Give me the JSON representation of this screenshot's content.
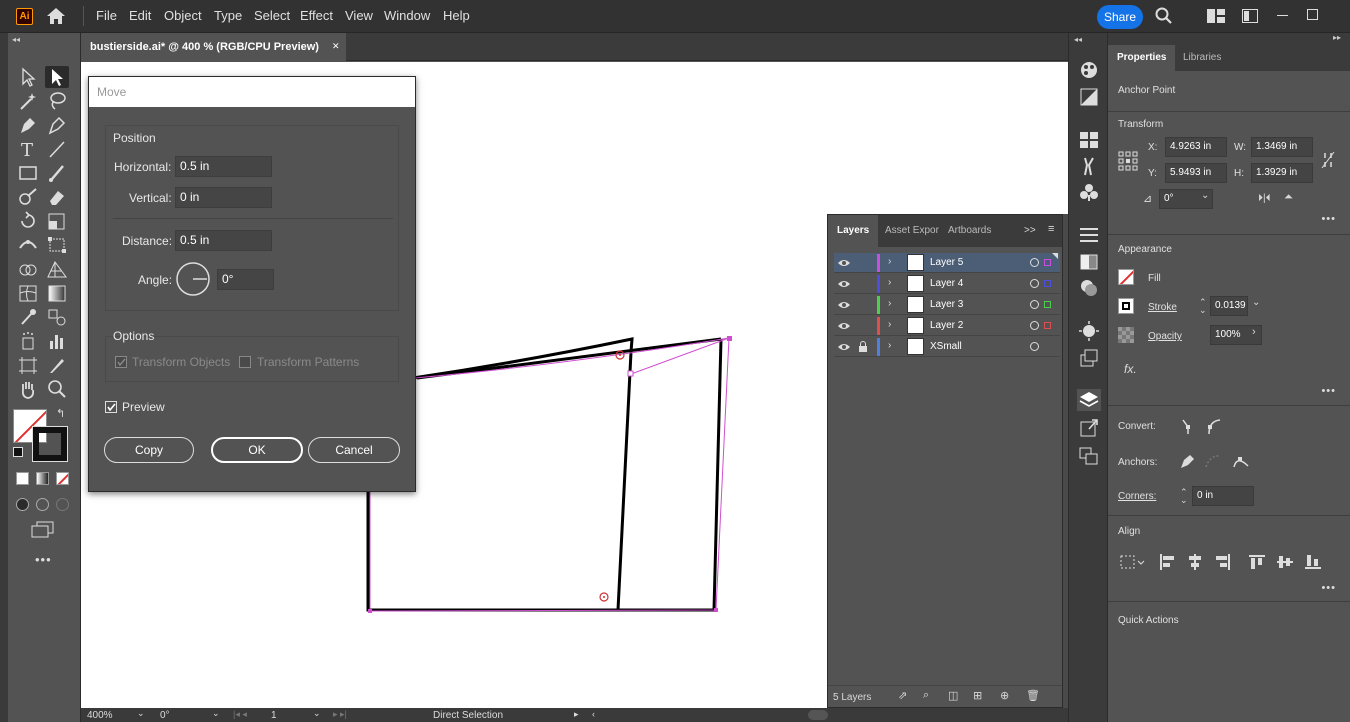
{
  "app": {
    "logo": "Ai",
    "menu": [
      "File",
      "Edit",
      "Object",
      "Type",
      "Select",
      "Effect",
      "View",
      "Window",
      "Help"
    ],
    "share_label": "Share"
  },
  "document": {
    "tab_title": "bustierside.ai* @ 400 % (RGB/CPU Preview)",
    "close_glyph": "✕"
  },
  "status": {
    "zoom": "400%",
    "rotation": "0°",
    "artboard": "1",
    "tool_name": "Direct Selection"
  },
  "move_dialog": {
    "title": "Move",
    "position_label": "Position",
    "horizontal_label": "Horizontal:",
    "horizontal_value": "0.5 in",
    "vertical_label": "Vertical:",
    "vertical_value": "0 in",
    "distance_label": "Distance:",
    "distance_value": "0.5 in",
    "angle_label": "Angle:",
    "angle_value": "0°",
    "options_label": "Options",
    "transform_objects": "Transform Objects",
    "transform_patterns": "Transform Patterns",
    "preview_label": "Preview",
    "preview_checked": true,
    "copy_label": "Copy",
    "ok_label": "OK",
    "cancel_label": "Cancel"
  },
  "layers_panel": {
    "tabs": [
      "Layers",
      "Asset Expor",
      "Artboards"
    ],
    "layers": [
      {
        "name": "Layer 5",
        "color": "#c84fe0",
        "selected": true,
        "locked": false
      },
      {
        "name": "Layer 4",
        "color": "#4f4fdf",
        "selected": false,
        "locked": false
      },
      {
        "name": "Layer 3",
        "color": "#4fcf4f",
        "selected": false,
        "locked": false
      },
      {
        "name": "Layer 2",
        "color": "#df4f4f",
        "selected": false,
        "locked": false
      },
      {
        "name": "XSmall",
        "color": "#4f7fdf",
        "selected": false,
        "locked": true
      }
    ],
    "count_label": "5 Layers"
  },
  "properties": {
    "tabs": [
      "Properties",
      "Libraries"
    ],
    "anchor_point": "Anchor Point",
    "transform_label": "Transform",
    "x_label": "X:",
    "x_value": "4.9263 in",
    "y_label": "Y:",
    "y_value": "5.9493 in",
    "w_label": "W:",
    "w_value": "1.3469 in",
    "h_label": "H:",
    "h_value": "1.3929 in",
    "rotate_value": "0°",
    "appearance_label": "Appearance",
    "fill_label": "Fill",
    "stroke_label": "Stroke",
    "stroke_value": "0.0139",
    "opacity_label": "Opacity",
    "opacity_value": "100%",
    "fx_label": "fx.",
    "convert_label": "Convert:",
    "anchors_label": "Anchors:",
    "corners_label": "Corners:",
    "corners_value": "0 in",
    "align_label": "Align",
    "quick_actions_label": "Quick Actions",
    "more_glyph": "•••"
  },
  "colors": {
    "accent": "#1473e6",
    "path_selection": "#d04fd0",
    "ui_dark": "#323232",
    "ui_mid": "#535353"
  },
  "icons": {
    "home": "home-icon",
    "search": "search-icon",
    "arrange": "arrange-documents-icon"
  }
}
